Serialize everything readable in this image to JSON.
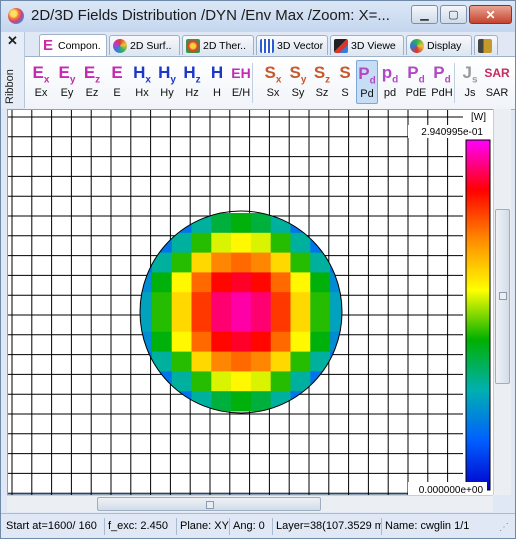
{
  "window": {
    "title": "2D/3D Fields Distribution /DYN /Env Max /Zoom: X=..."
  },
  "ribbon": {
    "label": "Ribbon",
    "close_symbol": "✕"
  },
  "tabs": [
    {
      "label": "Compon.",
      "icon": "e-component-icon",
      "active": true
    },
    {
      "label": "2D Surf..",
      "icon": "surface-icon"
    },
    {
      "label": "2D Ther..",
      "icon": "thermal-icon"
    },
    {
      "label": "3D Vector",
      "icon": "vector-icon"
    },
    {
      "label": "3D Viewe",
      "icon": "viewer-icon"
    },
    {
      "label": "Display",
      "icon": "display-icon"
    }
  ],
  "toolbar": [
    {
      "label": "Ex",
      "glyph": "E",
      "sub": "x"
    },
    {
      "label": "Ey",
      "glyph": "E",
      "sub": "y"
    },
    {
      "label": "Ez",
      "glyph": "E",
      "sub": "z"
    },
    {
      "label": "E",
      "glyph": "E",
      "sub": ""
    },
    {
      "label": "Hx",
      "glyph": "H",
      "sub": "x"
    },
    {
      "label": "Hy",
      "glyph": "H",
      "sub": "y"
    },
    {
      "label": "Hz",
      "glyph": "H",
      "sub": "z"
    },
    {
      "label": "H",
      "glyph": "H",
      "sub": ""
    },
    {
      "label": "E/H",
      "glyph": "EH",
      "sub": ""
    },
    {
      "label": "Sx",
      "glyph": "S",
      "sub": "x"
    },
    {
      "label": "Sy",
      "glyph": "S",
      "sub": "y"
    },
    {
      "label": "Sz",
      "glyph": "S",
      "sub": "z"
    },
    {
      "label": "S",
      "glyph": "S",
      "sub": ""
    },
    {
      "label": "Pd",
      "glyph": "P",
      "sub": "d",
      "selected": true
    },
    {
      "label": "pd",
      "glyph": "p",
      "sub": "d"
    },
    {
      "label": "PdE",
      "glyph": "P",
      "sub": "d"
    },
    {
      "label": "PdH",
      "glyph": "P",
      "sub": "d"
    },
    {
      "label": "Js",
      "glyph": "J",
      "sub": "s"
    },
    {
      "label": "SAR",
      "glyph": "SAR",
      "sub": ""
    }
  ],
  "plot": {
    "unit": "[W]",
    "max_label": "2.940995e-01",
    "min_label": "0.000000e+00",
    "colormap": [
      "#ff00ff",
      "#ff0000",
      "#ff8c00",
      "#ffff00",
      "#00b000",
      "#00b0b0",
      "#0060ff",
      "#0000cc"
    ],
    "field_levels": [
      [
        0,
        0,
        0,
        0.3,
        0.38,
        0.42,
        0.38,
        0.3,
        0,
        0,
        0
      ],
      [
        0,
        0,
        0.3,
        0.45,
        0.55,
        0.58,
        0.55,
        0.45,
        0.3,
        0,
        0
      ],
      [
        0,
        0.3,
        0.45,
        0.62,
        0.72,
        0.75,
        0.72,
        0.62,
        0.45,
        0.3,
        0
      ],
      [
        0.22,
        0.42,
        0.58,
        0.75,
        0.85,
        0.88,
        0.85,
        0.75,
        0.58,
        0.42,
        0.22
      ],
      [
        0.26,
        0.45,
        0.62,
        0.8,
        0.92,
        0.95,
        0.92,
        0.8,
        0.62,
        0.45,
        0.26
      ],
      [
        0.26,
        0.45,
        0.62,
        0.8,
        0.92,
        0.95,
        0.92,
        0.8,
        0.62,
        0.45,
        0.26
      ],
      [
        0.22,
        0.42,
        0.58,
        0.75,
        0.85,
        0.88,
        0.85,
        0.75,
        0.58,
        0.42,
        0.22
      ],
      [
        0,
        0.3,
        0.45,
        0.62,
        0.72,
        0.75,
        0.72,
        0.62,
        0.45,
        0.3,
        0
      ],
      [
        0,
        0,
        0.3,
        0.45,
        0.55,
        0.58,
        0.55,
        0.45,
        0.3,
        0,
        0
      ],
      [
        0,
        0,
        0,
        0.3,
        0.38,
        0.42,
        0.38,
        0.3,
        0,
        0,
        0
      ]
    ]
  },
  "status": [
    "Start at=1600/ 160",
    "f_exc:  2.450",
    "Plane: XY",
    "Ang:   0",
    "Layer=38(107.3529 m",
    "Name: cwglin 1/1"
  ]
}
